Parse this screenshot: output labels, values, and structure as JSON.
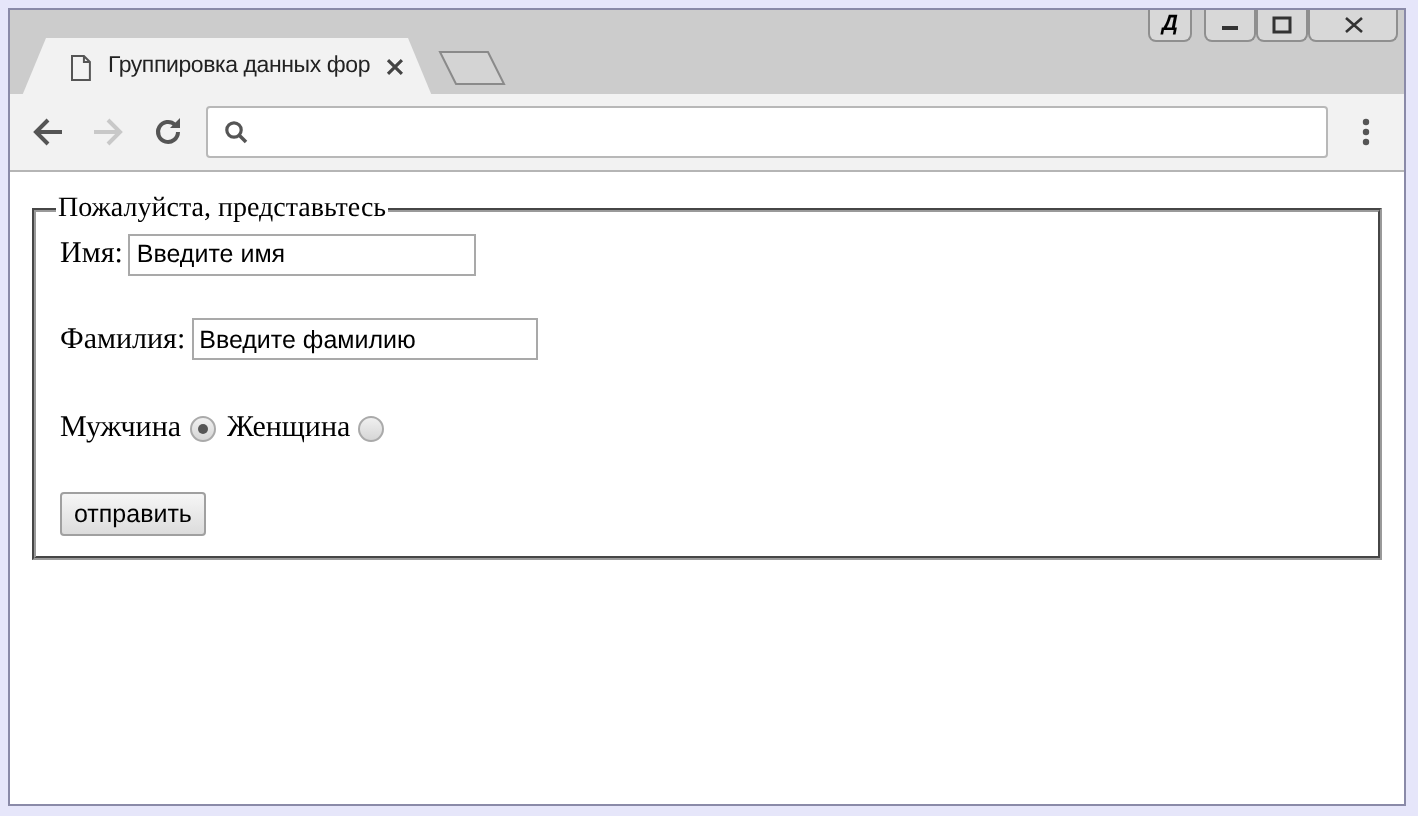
{
  "window": {
    "profile_label": "Д"
  },
  "tabs": [
    {
      "title": "Группировка данных фор",
      "selected": true,
      "kind": "page"
    },
    {
      "selected": false,
      "kind": "new"
    }
  ],
  "toolbar": {
    "forward_enabled": false
  },
  "form": {
    "legend": "Пожалуйста, представьтесь",
    "fields": [
      {
        "label": "Имя:",
        "value": "Введите имя"
      },
      {
        "label": "Фамилия:",
        "value": "Введите фамилию"
      }
    ],
    "radios": [
      {
        "label": "Мужчина",
        "selected": true
      },
      {
        "label": "Женщина",
        "selected": false
      }
    ],
    "submit": "отправить"
  }
}
